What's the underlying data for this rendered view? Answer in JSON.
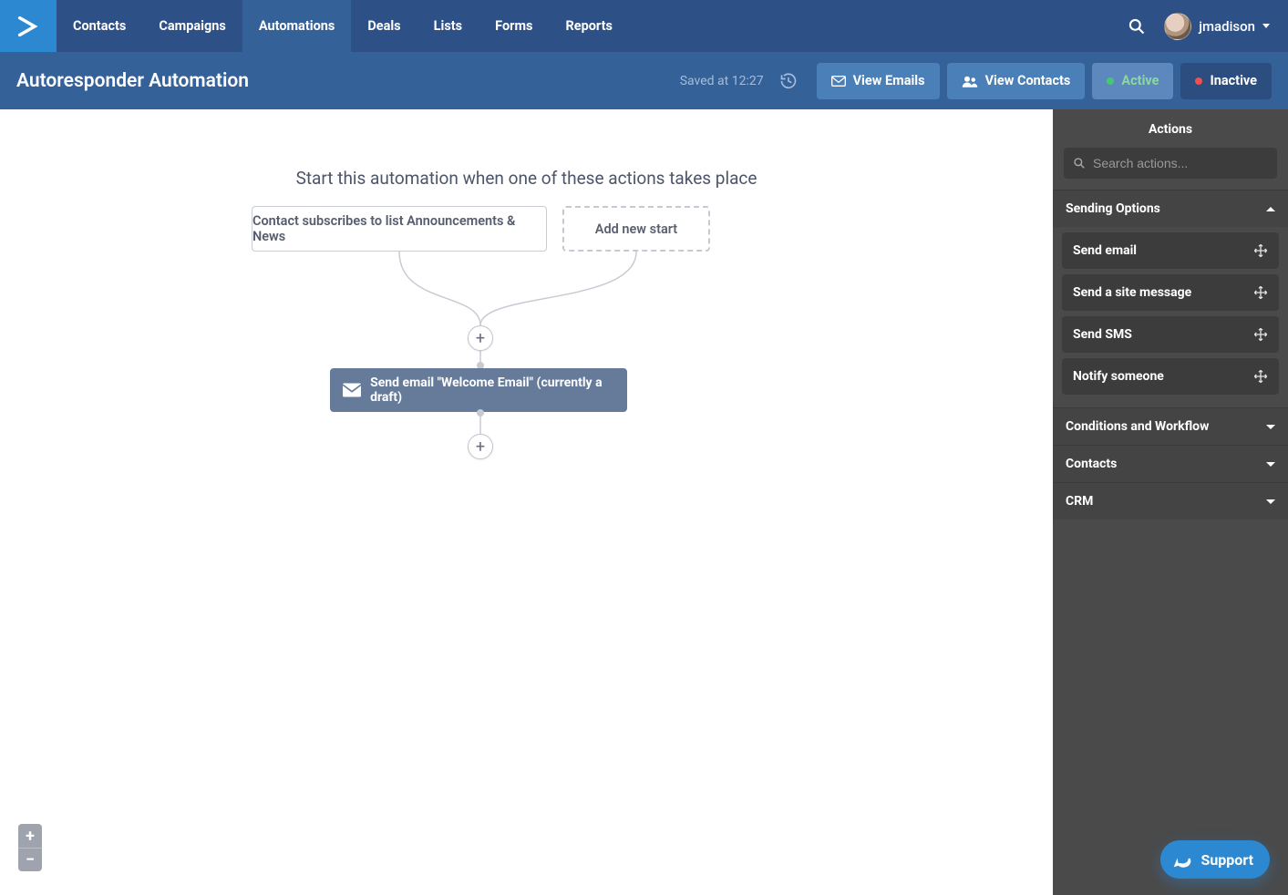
{
  "nav": {
    "items": [
      "Contacts",
      "Campaigns",
      "Automations",
      "Deals",
      "Lists",
      "Forms",
      "Reports"
    ],
    "activeIndex": 2,
    "username": "jmadison"
  },
  "subbar": {
    "title": "Autoresponder Automation",
    "savedAt": "Saved at 12:27",
    "viewEmails": "View Emails",
    "viewContacts": "View Contacts",
    "active": "Active",
    "inactive": "Inactive"
  },
  "canvas": {
    "startText": "Start this automation when one of these actions takes place",
    "startTrigger": "Contact subscribes to list Announcements & News",
    "addStart": "Add new start",
    "actionNode": "Send email \"Welcome Email\" (currently a draft)"
  },
  "sidebar": {
    "header": "Actions",
    "searchPlaceholder": "Search actions...",
    "groups": [
      {
        "label": "Sending Options",
        "expanded": true,
        "items": [
          "Send email",
          "Send a site message",
          "Send SMS",
          "Notify someone"
        ]
      },
      {
        "label": "Conditions and Workflow",
        "expanded": false
      },
      {
        "label": "Contacts",
        "expanded": false
      },
      {
        "label": "CRM",
        "expanded": false
      }
    ]
  },
  "support": {
    "label": "Support"
  }
}
